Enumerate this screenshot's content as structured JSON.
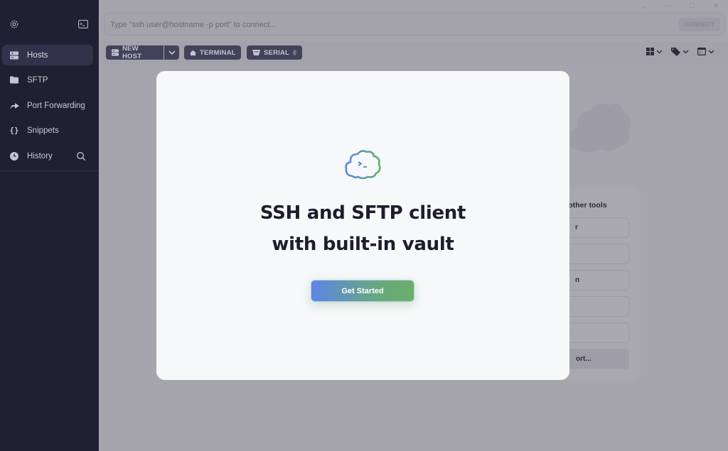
{
  "window_controls": [
    "chevron-down",
    "minimize",
    "maximize",
    "close"
  ],
  "sidebar": {
    "top_icons": [
      "gear-icon",
      "terminal-icon"
    ],
    "items": [
      {
        "label": "Hosts",
        "icon": "server-icon",
        "active": true
      },
      {
        "label": "SFTP",
        "icon": "folder-icon",
        "active": false
      },
      {
        "label": "Port Forwarding",
        "icon": "forward-arrow-icon",
        "active": false
      },
      {
        "label": "Snippets",
        "icon": "braces-icon",
        "active": false
      },
      {
        "label": "History",
        "icon": "clock-icon",
        "active": false
      }
    ]
  },
  "address_bar": {
    "placeholder": "Type \"ssh user@hostname -p port\" to connect...",
    "value": "",
    "connect_label": "CONNECT"
  },
  "toolbar": {
    "new_host_label": "NEW HOST",
    "terminal_label": "TERMINAL",
    "serial_label": "SERIAL",
    "right_tools": [
      "grid-view-icon",
      "tag-icon",
      "window-icon"
    ]
  },
  "background_panel": {
    "title_fragment": "n other tools",
    "options": [
      "r",
      "",
      "n",
      "",
      ""
    ],
    "import_fragment": "ort..."
  },
  "modal": {
    "headline_line1": "SSH and SFTP client",
    "headline_line2": "with built-in vault",
    "cta_label": "Get Started"
  },
  "colors": {
    "sidebar_bg": "#212032",
    "overlay_bg": "#a6a5ae",
    "modal_bg": "#f7f8fa",
    "cta_start": "#5b86e5",
    "cta_end": "#6aaf6a",
    "headline": "#1e1d2b"
  }
}
